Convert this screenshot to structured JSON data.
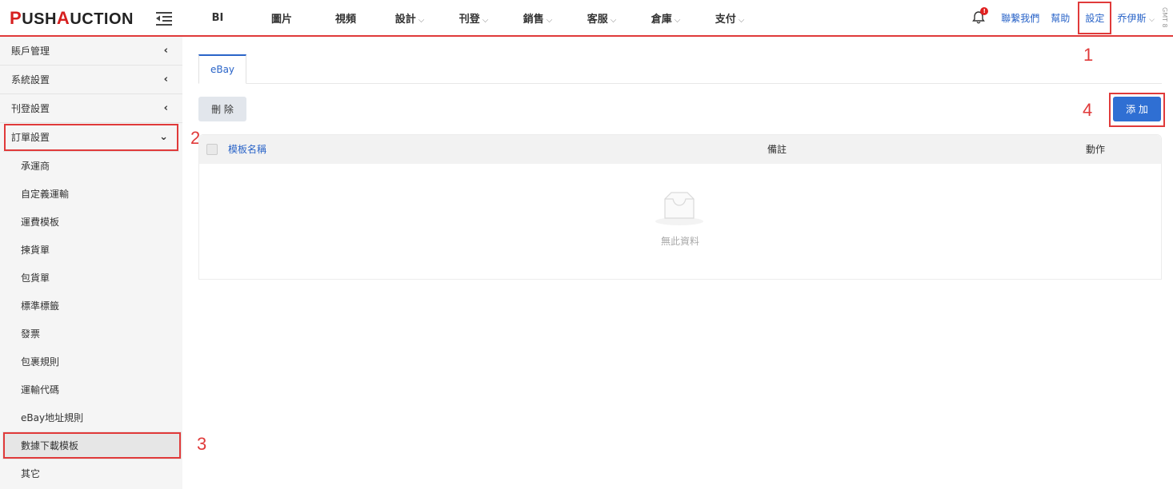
{
  "logo": {
    "p1": "P",
    "p2": "USH",
    "p3": "A",
    "p4": "UCTION"
  },
  "nav": {
    "items": [
      {
        "label": "BI",
        "chevron": false
      },
      {
        "label": "圖片",
        "chevron": false
      },
      {
        "label": "視頻",
        "chevron": false
      },
      {
        "label": "設計",
        "chevron": true
      },
      {
        "label": "刊登",
        "chevron": true
      },
      {
        "label": "銷售",
        "chevron": true
      },
      {
        "label": "客服",
        "chevron": true
      },
      {
        "label": "倉庫",
        "chevron": true
      },
      {
        "label": "支付",
        "chevron": true
      }
    ],
    "chevron_glyph": "⌵"
  },
  "topright": {
    "bell_badge": "!",
    "contact": "聯繫我們",
    "help": "幫助",
    "settings": "設定",
    "user": "乔伊斯",
    "user_chevron": "⌵",
    "gmt": "GMT 8"
  },
  "sidebar": {
    "groups": [
      {
        "label": "賬戶管理",
        "arrow": "‹"
      },
      {
        "label": "系統設置",
        "arrow": "‹"
      },
      {
        "label": "刊登設置",
        "arrow": "‹"
      },
      {
        "label": "訂單設置",
        "arrow": "⌄"
      }
    ],
    "subitems": [
      "承運商",
      "自定義運輸",
      "運費模板",
      "揀貨單",
      "包貨單",
      "標準標籤",
      "發票",
      "包裹規則",
      "運輸代碼",
      "eBay地址規則",
      "數據下載模板",
      "其它"
    ],
    "active_sub": "數據下載模板"
  },
  "main": {
    "tab": "eBay",
    "delete_button": "刪 除",
    "add_button": "添 加",
    "columns": {
      "name": "模板名稱",
      "note": "備註",
      "action": "動作"
    },
    "empty_text": "無此資料"
  },
  "annotations": {
    "a1": "1",
    "a2": "2",
    "a3": "3",
    "a4": "4"
  },
  "colors": {
    "accent": "#2f6fd3",
    "brand_red": "#d62020",
    "highlight_box": "#e03a3a"
  }
}
